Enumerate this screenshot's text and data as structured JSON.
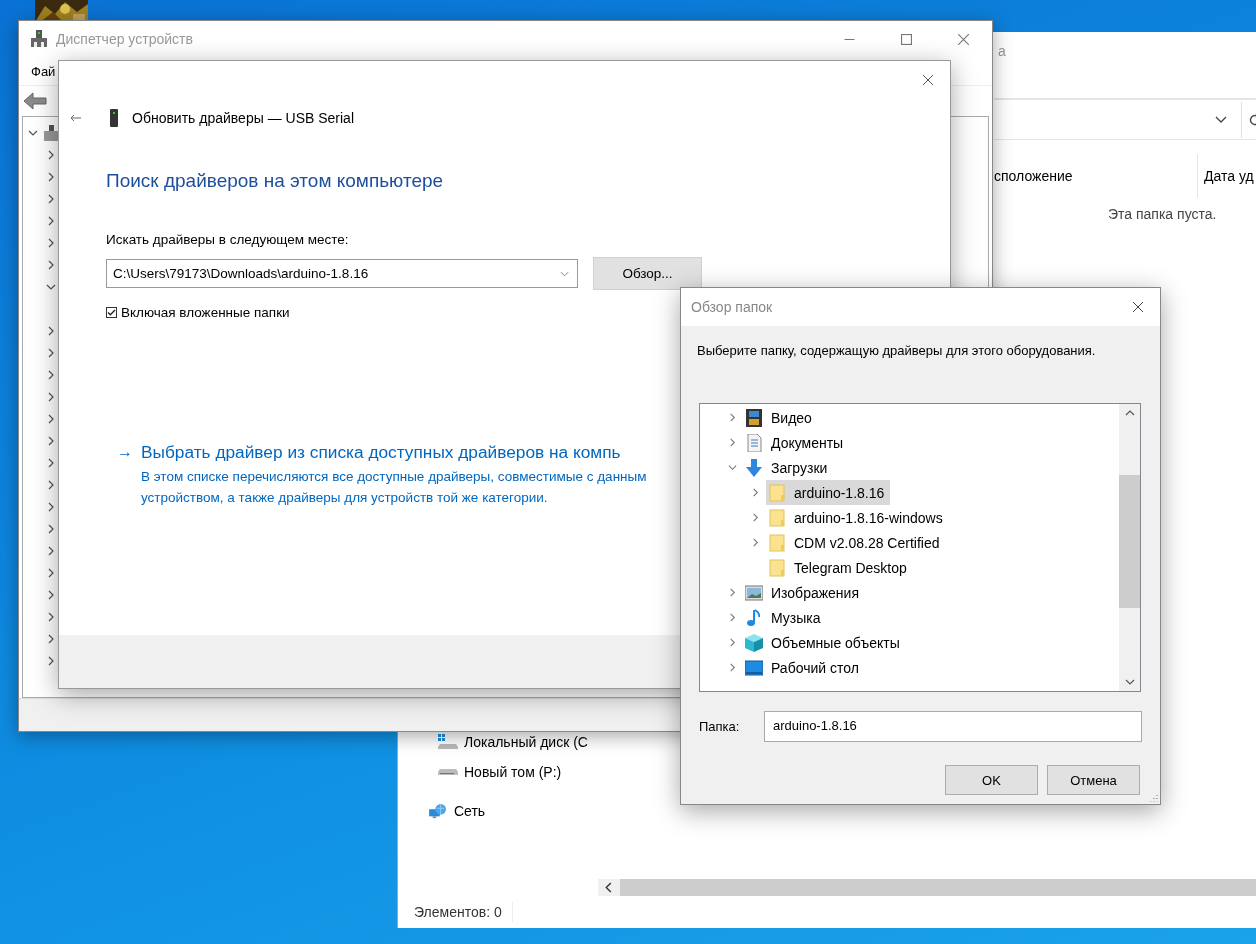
{
  "explorer": {
    "title_fragment": "а",
    "columns": [
      "сположение",
      "Дата уд"
    ],
    "empty_message": "Эта папка пуста.",
    "nav_items": [
      {
        "kind": "drive-windows",
        "label": "Локальный диск (C"
      },
      {
        "kind": "drive",
        "label": "Новый том (P:)"
      },
      {
        "kind": "network",
        "label": "Сеть"
      }
    ],
    "status": "Элементов: 0"
  },
  "device_manager": {
    "title": "Диспетчер устройств",
    "menu": [
      "Фай"
    ],
    "tree": [
      {
        "kind": "computer",
        "expanded": true,
        "children": [
          {
            "kind": "group",
            "expanded": false
          },
          {
            "kind": "group",
            "expanded": false
          },
          {
            "kind": "group",
            "expanded": false
          },
          {
            "kind": "group",
            "expanded": false
          },
          {
            "kind": "group",
            "expanded": false
          },
          {
            "kind": "group",
            "expanded": false
          },
          {
            "kind": "group",
            "expanded": true
          },
          {
            "kind": "group",
            "expanded": false
          },
          {
            "kind": "group",
            "expanded": false
          },
          {
            "kind": "group",
            "expanded": false
          },
          {
            "kind": "group",
            "expanded": false
          },
          {
            "kind": "group",
            "expanded": false
          },
          {
            "kind": "group",
            "expanded": false
          },
          {
            "kind": "group",
            "expanded": false
          },
          {
            "kind": "group",
            "expanded": false
          },
          {
            "kind": "group",
            "expanded": false
          },
          {
            "kind": "group",
            "expanded": false
          },
          {
            "kind": "group",
            "expanded": false
          },
          {
            "kind": "group",
            "expanded": false
          },
          {
            "kind": "group",
            "expanded": false
          },
          {
            "kind": "group",
            "expanded": false
          },
          {
            "kind": "group",
            "expanded": false
          },
          {
            "kind": "group",
            "expanded": false
          }
        ]
      }
    ]
  },
  "update_dialog": {
    "title": "Обновить драйверы — USB Serial",
    "heading": "Поиск драйверов на этом компьютере",
    "location_label": "Искать драйверы в следующем месте:",
    "location_value": "C:\\Users\\79173\\Downloads\\arduino-1.8.16",
    "browse_button": "Обзор...",
    "include_subfolders": {
      "label": "Включая вложенные папки",
      "checked": true
    },
    "link_arrow": "→",
    "link": "Выбрать драйвер из списка доступных драйверов на компь",
    "link_description": "В этом списке перечисляются все доступные драйверы, совместимые с данным устройством, а также драйверы для устройств той же категории."
  },
  "browse_dialog": {
    "title": "Обзор папок",
    "instruction": "Выберите папку, содержащую драйверы для этого оборудования.",
    "tree": [
      {
        "kind": "video",
        "label": "Видео",
        "expanded": false,
        "selected": false
      },
      {
        "kind": "documents",
        "label": "Документы",
        "expanded": false,
        "selected": false
      },
      {
        "kind": "downloads",
        "label": "Загрузки",
        "expanded": true,
        "selected": false,
        "children": [
          {
            "kind": "folder",
            "label": "arduino-1.8.16",
            "expanded": false,
            "selected": true
          },
          {
            "kind": "folder",
            "label": "arduino-1.8.16-windows",
            "expanded": false,
            "selected": false
          },
          {
            "kind": "folder",
            "label": "CDM v2.08.28 Certified",
            "expanded": false,
            "selected": false
          },
          {
            "kind": "folder-leaf",
            "label": "Telegram Desktop",
            "selected": false
          }
        ]
      },
      {
        "kind": "pictures",
        "label": "Изображения",
        "expanded": false,
        "selected": false
      },
      {
        "kind": "music",
        "label": "Музыка",
        "expanded": false,
        "selected": false
      },
      {
        "kind": "objects3d",
        "label": "Объемные объекты",
        "expanded": false,
        "selected": false
      },
      {
        "kind": "desktop",
        "label": "Рабочий стол",
        "expanded": false,
        "selected": false
      }
    ],
    "folder_label": "Папка:",
    "folder_value": "arduino-1.8.16",
    "buttons": [
      "OK",
      "Отмена"
    ]
  }
}
